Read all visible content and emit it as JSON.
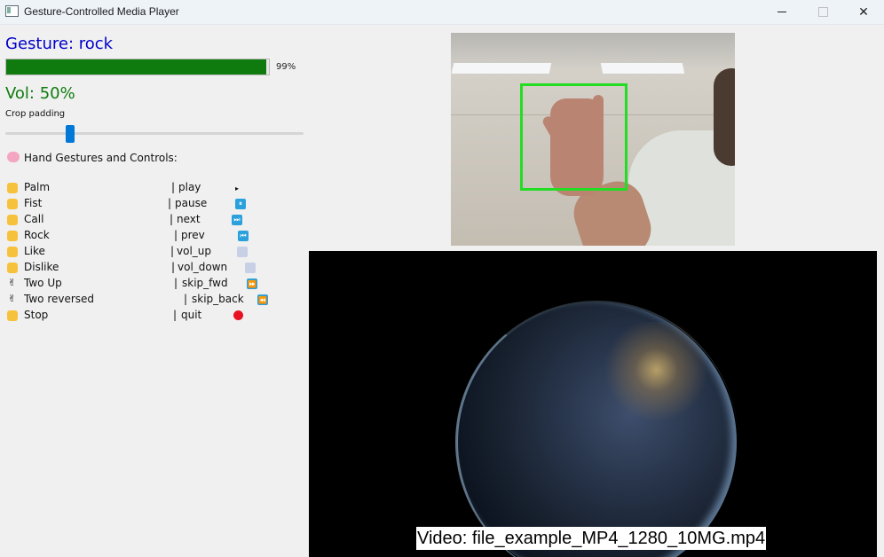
{
  "window": {
    "title": "Gesture-Controlled Media Player",
    "minimize_icon": "minimize-icon",
    "maximize_icon": "maximize-icon",
    "close_icon": "close-icon",
    "close_glyph": "✕"
  },
  "status": {
    "gesture_label": "Gesture: rock",
    "confidence_percent": 99,
    "confidence_text": "99%",
    "volume_label": "Vol: 50%",
    "crop_label": "Crop padding",
    "crop_padding_fraction": 0.21
  },
  "controls": {
    "title": "Hand Gestures and Controls:",
    "title_icon": "brain-icon",
    "rows": [
      {
        "icon": "open-palm-icon",
        "name": "Palm",
        "sep": "|",
        "action": "play",
        "action_icon": "play-icon",
        "glyph": "▸"
      },
      {
        "icon": "fist-icon",
        "name": "Fist",
        "sep": "|",
        "action": "pause",
        "action_icon": "pause-icon",
        "glyph": "⏸"
      },
      {
        "icon": "call-hand-icon",
        "name": "Call",
        "sep": "|",
        "action": "next",
        "action_icon": "next-track-icon",
        "glyph": "⏭"
      },
      {
        "icon": "rock-hand-icon",
        "name": "Rock",
        "sep": "|",
        "action": "prev",
        "action_icon": "previous-track-icon",
        "glyph": "⏮"
      },
      {
        "icon": "thumbs-up-icon",
        "name": "Like",
        "sep": "|",
        "action": "vol_up",
        "action_icon": "speaker-icon",
        "glyph": ""
      },
      {
        "icon": "thumbs-down-icon",
        "name": "Dislike",
        "sep": "|",
        "action": "vol_down",
        "action_icon": "speaker-icon",
        "glyph": ""
      },
      {
        "icon": "victory-hand-icon",
        "name": "Two Up",
        "sep": "|",
        "action": "skip_fwd",
        "action_icon": "fast-forward-icon",
        "glyph": "⏩"
      },
      {
        "icon": "victory-hand-icon",
        "name": "Two reversed",
        "sep": "|",
        "action": "skip_back",
        "action_icon": "rewind-icon",
        "glyph": "⏪"
      },
      {
        "icon": "raised-hand-icon",
        "name": "Stop",
        "sep": "|",
        "action": "quit",
        "action_icon": "red-circle-icon",
        "glyph": ""
      }
    ]
  },
  "video": {
    "caption": "Video: file_example_MP4_1280_10MG.mp4"
  },
  "colors": {
    "gesture_text": "#0000cc",
    "confidence_bar": "#0f7b0f",
    "volume_text": "#0f7b0f",
    "detection_box": "#22dd22",
    "slider_accent": "#0078d7"
  }
}
